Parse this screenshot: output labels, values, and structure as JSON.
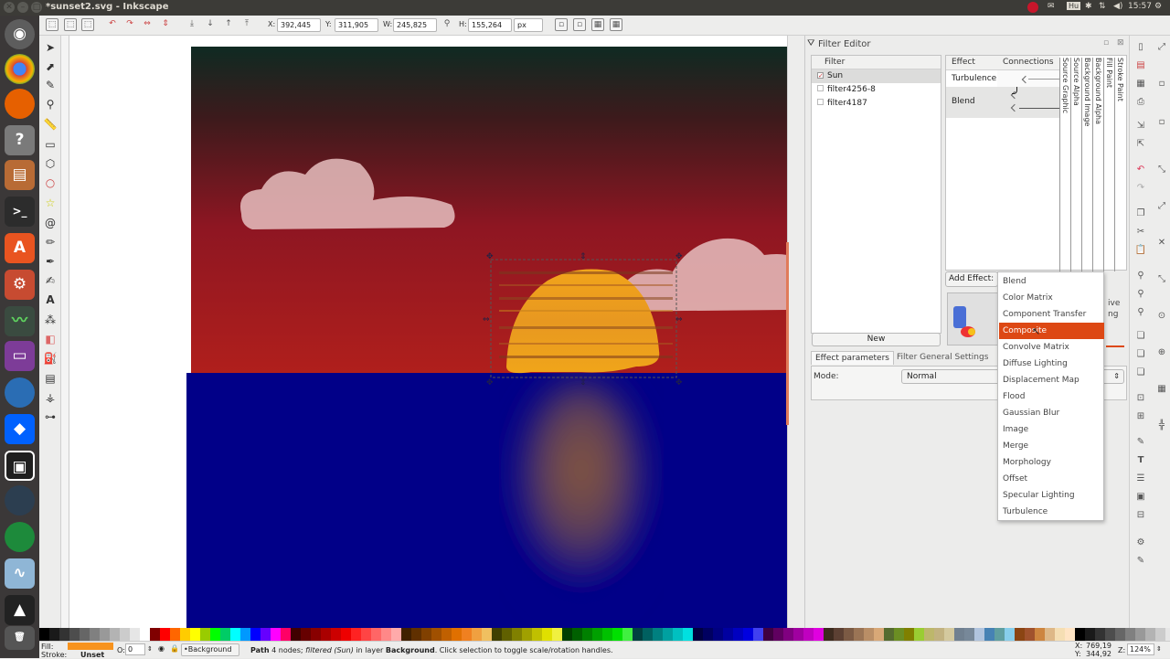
{
  "window": {
    "title": "*sunset2.svg - Inkscape"
  },
  "tray": {
    "clock": "15:57",
    "keyboard": "Hu"
  },
  "controls": {
    "x_label": "X:",
    "x_value": "392,445",
    "y_label": "Y:",
    "y_value": "311,905",
    "w_label": "W:",
    "w_value": "245,825",
    "h_label": "H:",
    "h_value": "155,264",
    "unit": "px"
  },
  "filter_editor": {
    "title": "Filter Editor",
    "filter_header": "Filter",
    "filters": [
      {
        "name": "Sun",
        "checked": true
      },
      {
        "name": "filter4256-8",
        "checked": false
      },
      {
        "name": "filter4187",
        "checked": false
      }
    ],
    "new_button": "New",
    "effect_header": "Effect",
    "connections_header": "Connections",
    "effects": [
      "Turbulence",
      "Blend"
    ],
    "connection_inputs": [
      "Source Graphic",
      "Source Alpha",
      "Background Image",
      "Background Alpha",
      "Fill Paint",
      "Stroke Paint"
    ],
    "add_effect_label": "Add Effect:",
    "side_text_1": "ive",
    "side_text_2": "ng",
    "tabs": [
      "Effect parameters",
      "Filter General Settings"
    ],
    "mode_label": "Mode:",
    "mode_value": "Normal"
  },
  "effect_menu": {
    "items": [
      "Blend",
      "Color Matrix",
      "Component Transfer",
      "Composite",
      "Convolve Matrix",
      "Diffuse Lighting",
      "Displacement Map",
      "Flood",
      "Gaussian Blur",
      "Image",
      "Merge",
      "Morphology",
      "Offset",
      "Specular Lighting",
      "Turbulence"
    ],
    "selected": "Composite"
  },
  "status": {
    "fill_label": "Fill:",
    "stroke_label": "Stroke:",
    "stroke_value": "Unset",
    "opacity_label": "O:",
    "opacity_value": "0",
    "layer": "•Background",
    "message_1": "Path",
    "message_2": " 4 nodes; ",
    "message_3": "filtered (Sun)",
    "message_4": " in layer ",
    "message_5": "Background",
    "message_6": ". Click selection to toggle scale/rotation handles.",
    "coord_x_label": "X:",
    "coord_x": "769,19",
    "coord_y_label": "Y:",
    "coord_y": "344,92",
    "zoom_label": "Z:",
    "zoom": "124%"
  },
  "colors": {
    "accent": "#dd4814",
    "sky_top": "#0f2a22",
    "sky_red": "#8e1622",
    "sea": "#010088",
    "sun": "#f1a41b",
    "cloud": "#e6c0bf",
    "fill_swatch": "#f7931e"
  }
}
